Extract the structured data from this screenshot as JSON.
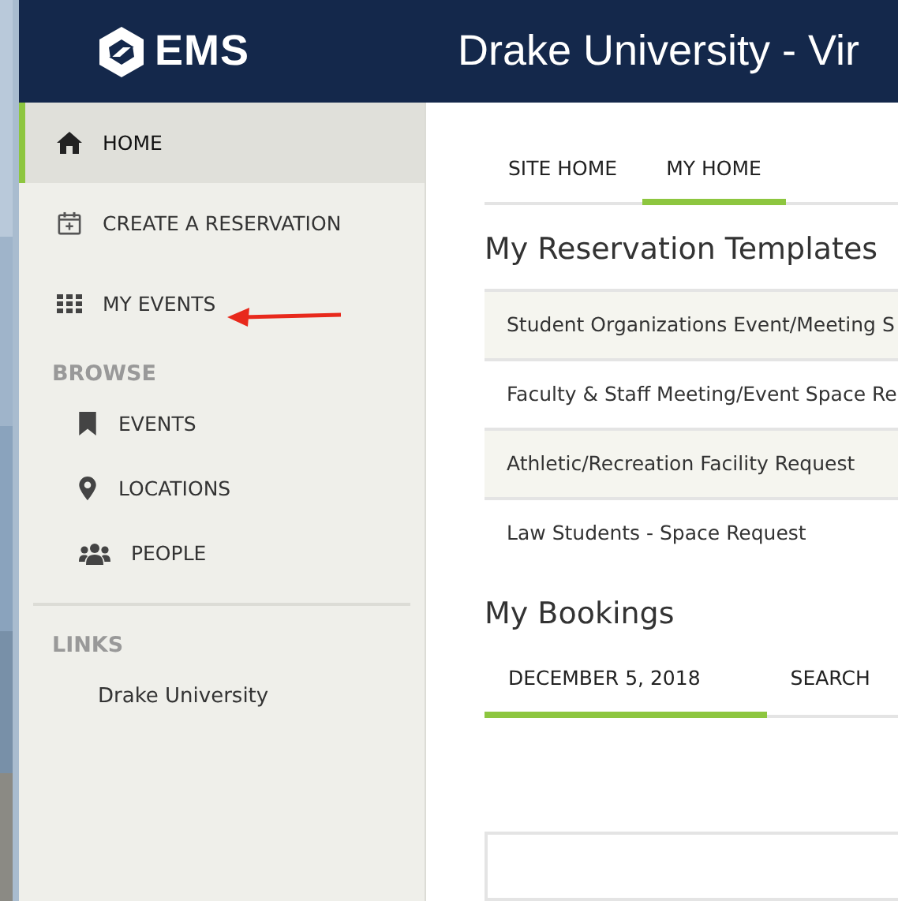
{
  "header": {
    "logo_text": "EMS",
    "title": "Drake University - Vir"
  },
  "sidebar": {
    "items": [
      {
        "label": "HOME",
        "selected": true
      },
      {
        "label": "CREATE A RESERVATION",
        "selected": false
      },
      {
        "label": "MY EVENTS",
        "selected": false
      }
    ],
    "browse": {
      "heading": "BROWSE",
      "items": [
        {
          "label": "EVENTS"
        },
        {
          "label": "LOCATIONS"
        },
        {
          "label": "PEOPLE"
        }
      ]
    },
    "links": {
      "heading": "LINKS",
      "items": [
        "Drake University"
      ]
    }
  },
  "main": {
    "tabs": [
      {
        "label": "SITE HOME",
        "selected": false
      },
      {
        "label": "MY HOME",
        "selected": true
      }
    ],
    "templates": {
      "heading": "My Reservation Templates",
      "rows": [
        "Student Organizations Event/Meeting S",
        "Faculty & Staff Meeting/Event Space Re",
        "Athletic/Recreation Facility Request",
        "Law Students - Space Request"
      ]
    },
    "bookings": {
      "heading": "My Bookings",
      "tabs": [
        {
          "label": "DECEMBER 5, 2018",
          "selected": true
        },
        {
          "label": "SEARCH",
          "selected": false
        }
      ]
    }
  }
}
